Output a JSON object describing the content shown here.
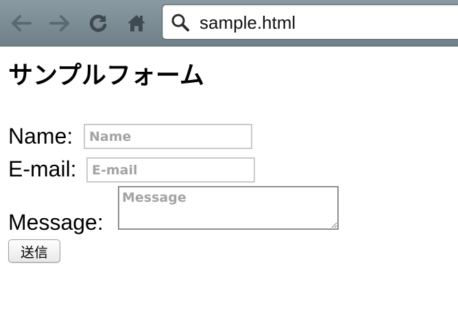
{
  "browser": {
    "url": "sample.html",
    "buttons": {
      "back": "arrow-left-icon",
      "forward": "arrow-right-icon",
      "reload": "reload-icon",
      "home": "home-icon"
    }
  },
  "page": {
    "title": "サンプルフォーム",
    "form": {
      "name_label": "Name:",
      "name_placeholder": "Name",
      "email_label": "E-mail:",
      "email_placeholder": "E-mail",
      "message_label": "Message:",
      "message_placeholder": "Message",
      "submit_label": "送信"
    }
  },
  "colors": {
    "toolbar": "#7d8e97",
    "field_border": "#c9c9c9",
    "placeholder": "#a3a3a3"
  }
}
